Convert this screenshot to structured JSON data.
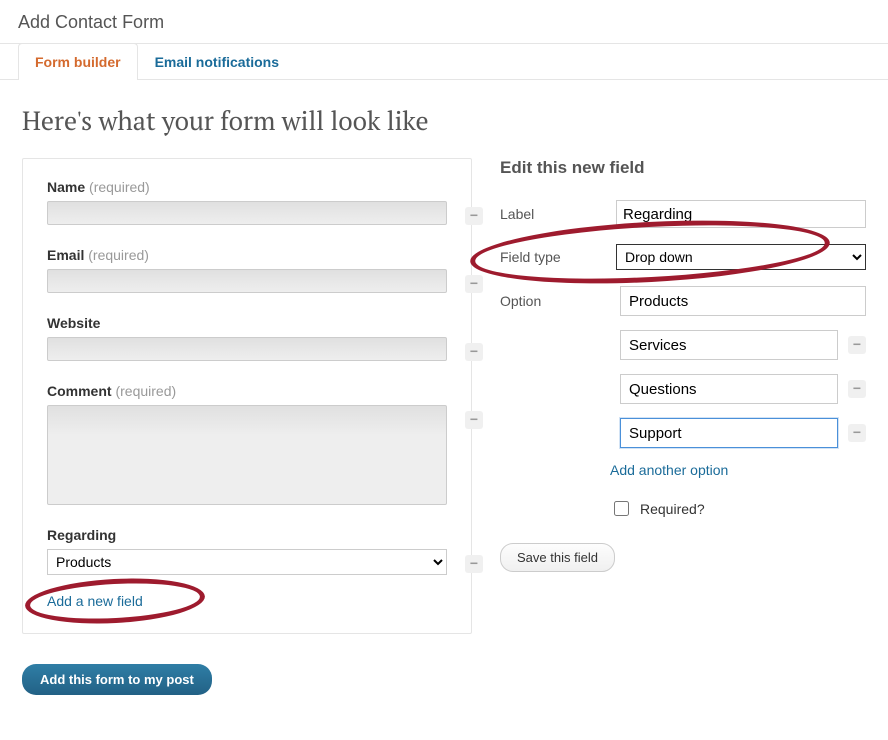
{
  "page_title": "Add Contact Form",
  "tabs": {
    "builder": "Form builder",
    "notifications": "Email notifications"
  },
  "preview": {
    "heading": "Here's what your form will look like",
    "fields": {
      "name": {
        "label": "Name",
        "req": "(required)"
      },
      "email": {
        "label": "Email",
        "req": "(required)"
      },
      "website": {
        "label": "Website"
      },
      "comment": {
        "label": "Comment",
        "req": "(required)"
      },
      "regarding": {
        "label": "Regarding",
        "selected": "Products"
      }
    },
    "add_field": "Add a new field",
    "submit": "Add this form to my post"
  },
  "edit": {
    "heading": "Edit this new field",
    "label_label": "Label",
    "label_value": "Regarding",
    "type_label": "Field type",
    "type_value": "Drop down",
    "option_label": "Option",
    "options": [
      "Products",
      "Services",
      "Questions",
      "Support"
    ],
    "add_option": "Add another option",
    "required_label": "Required?",
    "save": "Save this field"
  }
}
